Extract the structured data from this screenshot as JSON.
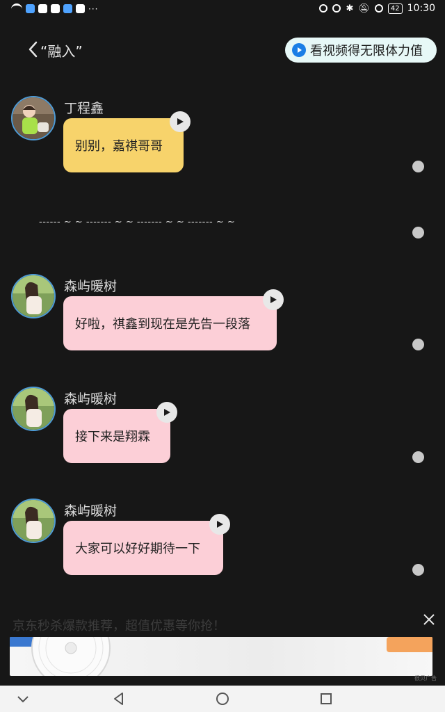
{
  "status_bar": {
    "time": "10:30",
    "battery": "42",
    "left_icons": [
      "wifi-icon",
      "message-icon",
      "app-icon",
      "shield-icon",
      "app-icon",
      "app-icon"
    ],
    "overflow": "···",
    "right_icons": [
      "eye-icon",
      "alarm-icon",
      "bluetooth-icon",
      "mute-icon",
      "data-saver-icon"
    ]
  },
  "header": {
    "title": "“融入”",
    "promo_label": "看视频得无限体力值"
  },
  "messages": [
    {
      "name": "丁程鑫",
      "text": "别别，嘉祺哥哥",
      "bubble_color": "#f7d36b"
    },
    {
      "name": "森屿暖树",
      "text": "好啦，祺鑫到现在是先告一段落",
      "bubble_color": "#fccfd7"
    },
    {
      "name": "森屿暖树",
      "text": "接下来是翔霖",
      "bubble_color": "#fccfd7"
    },
    {
      "name": "森屿暖树",
      "text": "大家可以好好期待一下",
      "bubble_color": "#fccfd7"
    }
  ],
  "divider_text": "------ ~ ~ ------- ~ ~ ------- ~ ~ ------- ~ ~",
  "ad": {
    "text": "京东秒杀爆款推荐，超值优惠等你抢！",
    "label": "很贝广告"
  },
  "colors": {
    "background": "#171717",
    "promo_bg": "#e7f8f7",
    "promo_accent": "#1a7ee6",
    "avatar_ring": "#4e9bd6"
  }
}
